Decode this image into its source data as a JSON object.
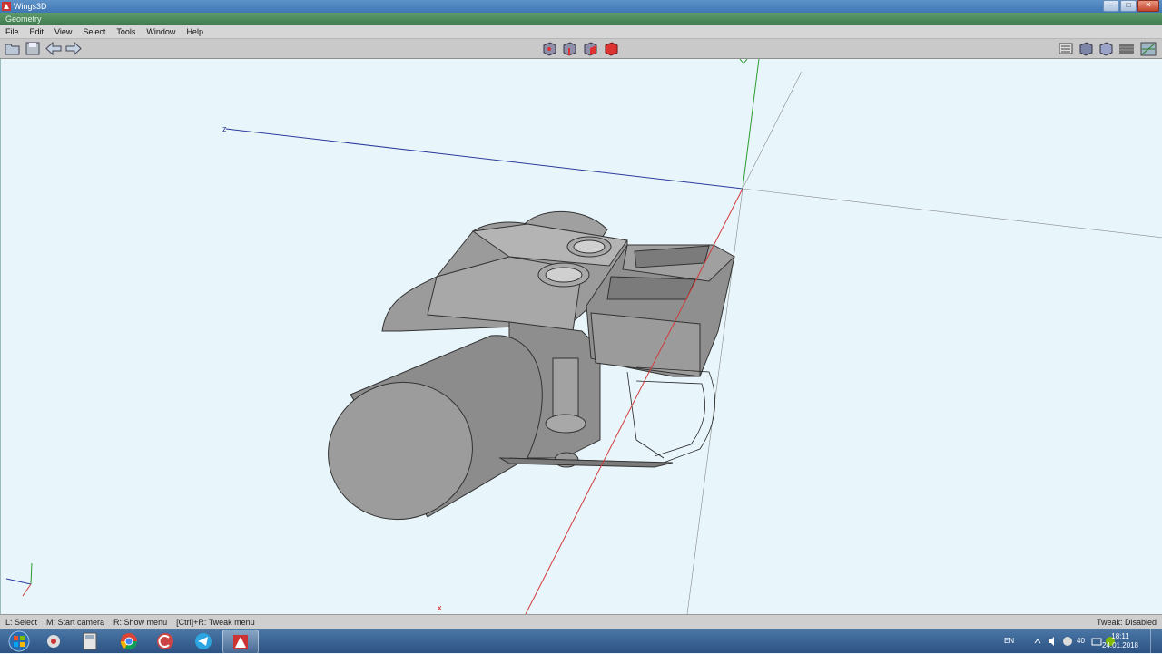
{
  "window": {
    "title": "Wings3D",
    "panel_title": "Geometry",
    "minimize": "–",
    "maximize": "□",
    "close": "✕"
  },
  "menu": [
    "File",
    "Edit",
    "View",
    "Select",
    "Tools",
    "Window",
    "Help"
  ],
  "toolbar": {
    "left_icons": [
      "open-icon",
      "save-icon",
      "undo-arrow-icon",
      "redo-arrow-icon"
    ],
    "select_modes": [
      "vertex-mode-icon",
      "edge-mode-icon",
      "face-mode-icon",
      "body-mode-icon"
    ],
    "right_icons": [
      "workmode-icon",
      "smooth-shading-icon",
      "flat-shading-icon",
      "wireframe-icon",
      "perspective-icon"
    ]
  },
  "viewport": {
    "axis_labels": {
      "z": "z",
      "x": "x",
      "y": "y"
    },
    "colors": {
      "background": "#e8f6fc",
      "x_axis": "#d23a3a",
      "y_axis": "#2a9a2a",
      "z_axis": "#2a3a9a",
      "model": "#9a9a9a"
    }
  },
  "status": {
    "hints": [
      "L: Select",
      "M: Start camera",
      "R: Show menu",
      "[Ctrl]+R: Tweak menu"
    ],
    "tweak": "Tweak: Disabled"
  },
  "taskbar": {
    "apps": [
      "start-button",
      "app-icon-1",
      "calculator-icon",
      "chrome-icon",
      "ccleaner-icon",
      "telegram-icon",
      "wings3d-icon"
    ],
    "language": "EN",
    "volume": "40",
    "time": "18:11",
    "date": "24.01.2018"
  }
}
